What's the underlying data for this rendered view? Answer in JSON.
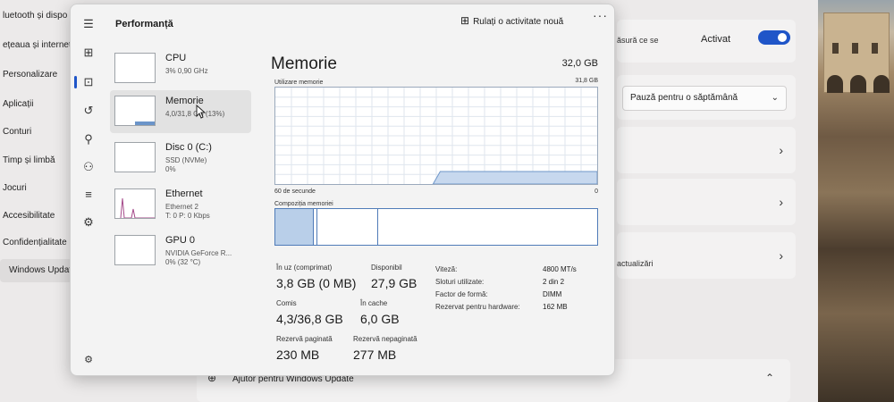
{
  "settings": {
    "nav": [
      {
        "label": "luetooth și dispo"
      },
      {
        "label": "ețeaua și internet"
      },
      {
        "label": "Personalizare"
      },
      {
        "label": "Aplicații"
      },
      {
        "label": "Conturi"
      },
      {
        "label": "Timp și limbă"
      },
      {
        "label": "Jocuri"
      },
      {
        "label": "Accesibilitate"
      },
      {
        "label": "Confidențialitate"
      },
      {
        "label": "Windows Update"
      }
    ],
    "get_updates_text": "ăsură ce se",
    "toggle_label": "Activat",
    "pause_dropdown": "Pauză pentru o săptămână",
    "updates_text": "actualizări",
    "help_label": "Ajutor pentru Windows Update",
    "accent_color": "#1f55c8"
  },
  "taskmanager": {
    "title": "Performanță",
    "run_task_label": "Rulați o activitate nouă",
    "more_label": "···",
    "processes": [
      {
        "name": "CPU",
        "detail": "3% 0,90 GHz",
        "detail2": ""
      },
      {
        "name": "Memorie",
        "detail": "4,0/31,8 GB (13%)",
        "detail2": ""
      },
      {
        "name": "Disc 0 (C:)",
        "detail": "SSD (NVMe)",
        "detail2": "0%"
      },
      {
        "name": "Ethernet",
        "detail": "Ethernet 2",
        "detail2": "T: 0 P: 0 Kbps"
      },
      {
        "name": "GPU 0",
        "detail": "NVIDIA GeForce R...",
        "detail2": "0% (32 °C)"
      }
    ],
    "memory": {
      "title": "Memorie",
      "total": "32,0 GB",
      "usage_label": "Utilizare memorie",
      "usage_max": "31,8 GB",
      "axis_left": "60 de secunde",
      "axis_right": "0",
      "usage_fraction": 0.13,
      "composition_label": "Compoziția memoriei",
      "composition": {
        "in_use": 0.12,
        "modified": 0.01,
        "standby": 0.19
      },
      "stats": {
        "in_use_label": "În uz (comprimat)",
        "in_use_value": "3,8 GB (0 MB)",
        "available_label": "Disponibil",
        "available_value": "27,9 GB",
        "committed_label": "Comis",
        "committed_value": "4,3/36,8 GB",
        "cached_label": "În cache",
        "cached_value": "6,0 GB",
        "paged_label": "Rezervă paginată",
        "paged_value": "230 MB",
        "nonpaged_label": "Rezervă nepaginată",
        "nonpaged_value": "277 MB"
      },
      "props": [
        {
          "label": "Viteză:",
          "value": "4800 MT/s"
        },
        {
          "label": "Sloturi utilizate:",
          "value": "2 din 2"
        },
        {
          "label": "Factor de formă:",
          "value": "DIMM"
        },
        {
          "label": "Rezervat pentru hardware:",
          "value": "162 MB"
        }
      ]
    }
  }
}
